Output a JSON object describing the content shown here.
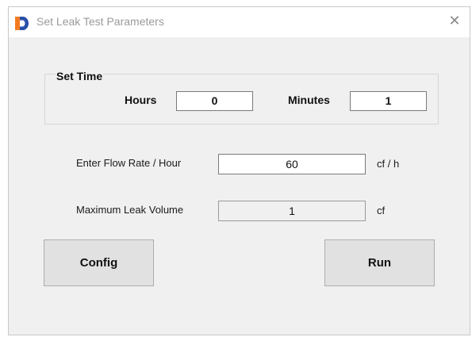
{
  "window": {
    "title": "Set Leak Test Parameters",
    "close_glyph": "✕"
  },
  "set_time": {
    "group_label": "Set Time",
    "hours_label": "Hours",
    "hours_value": "0",
    "minutes_label": "Minutes",
    "minutes_value": "1"
  },
  "flow_rate": {
    "label": "Enter Flow Rate / Hour",
    "value": "60",
    "unit": "cf / h"
  },
  "leak_volume": {
    "label": "Maximum Leak Volume",
    "value": "1",
    "unit": "cf"
  },
  "buttons": {
    "config": "Config",
    "run": "Run"
  },
  "colors": {
    "icon_orange": "#f47b20",
    "icon_blue": "#2a4fa8"
  }
}
